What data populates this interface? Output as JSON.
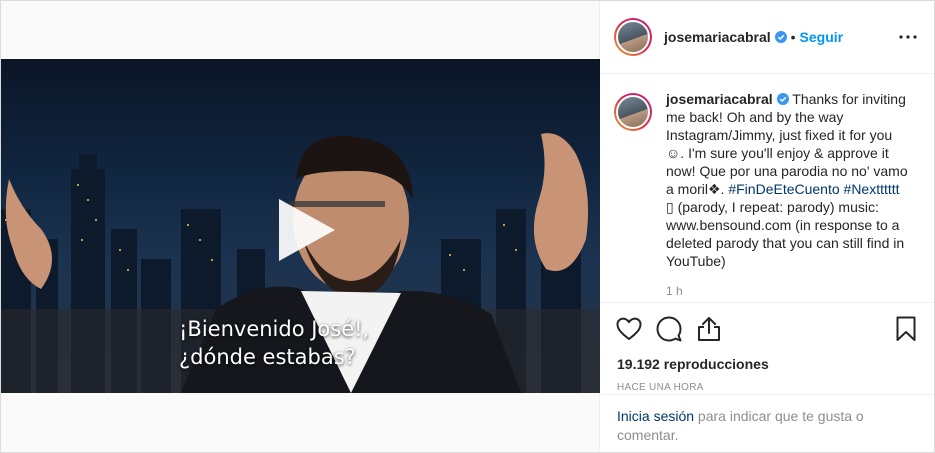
{
  "video": {
    "subtitle_line1": "¡Bienvenido José!,",
    "subtitle_line2": "¿dónde estabas?",
    "play_icon": "play-icon"
  },
  "header": {
    "username": "josemariacabral",
    "separator": "•",
    "follow_label": "Seguir",
    "verified_icon": "verified-badge-icon",
    "more_icon": "more-options-icon"
  },
  "caption": {
    "username": "josemariacabral",
    "text_part1": " Thanks for inviting me back! Oh and by the way Instagram/Jimmy, just fixed it for you ☺. I'm sure you'll enjoy & approve it now! Que por una parodia no no' vamo a moril❖. ",
    "hashtag1": "#FinDeEteCuento",
    "text_part2": " ",
    "hashtag2": "#Nextttttt",
    "text_part3": " ▯ (parody, I repeat: parody) music: www.bensound.com (in response to a deleted parody that you can still find in YouTube)",
    "more_hint": "1 h"
  },
  "actions": {
    "like_icon": "heart-icon",
    "comment_icon": "comment-icon",
    "share_icon": "share-icon",
    "save_icon": "bookmark-icon"
  },
  "stats": {
    "views": "19.192 reproducciones",
    "time": "HACE UNA HORA"
  },
  "login": {
    "link": "Inicia sesión",
    "text": " para indicar que te gusta o comentar."
  },
  "colors": {
    "accent": "#0095f6",
    "link": "#00376b",
    "muted": "#8e8e8e",
    "text": "#262626"
  }
}
